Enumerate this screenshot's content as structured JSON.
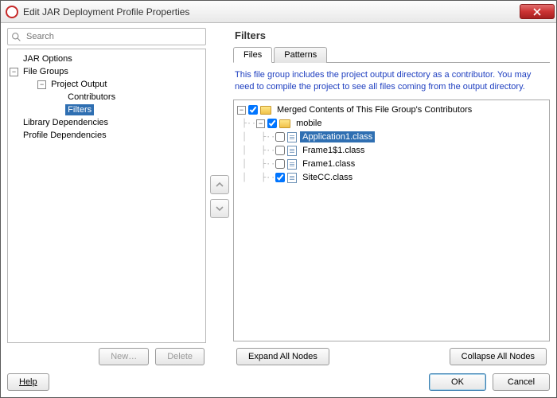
{
  "window": {
    "title": "Edit JAR Deployment Profile Properties"
  },
  "search": {
    "placeholder": "Search"
  },
  "navTree": [
    {
      "indent": 0,
      "toggle": "",
      "label": "JAR Options",
      "selected": false
    },
    {
      "indent": 0,
      "toggle": "-",
      "label": "File Groups",
      "selected": false
    },
    {
      "indent": 1,
      "toggle": "-",
      "label": "Project Output",
      "selected": false
    },
    {
      "indent": 2,
      "toggle": "",
      "label": "Contributors",
      "selected": false
    },
    {
      "indent": 2,
      "toggle": "",
      "label": "Filters",
      "selected": true
    },
    {
      "indent": 0,
      "toggle": "",
      "label": "Library Dependencies",
      "selected": false
    },
    {
      "indent": 0,
      "toggle": "",
      "label": "Profile Dependencies",
      "selected": false
    }
  ],
  "leftButtons": {
    "new": "New…",
    "delete": "Delete"
  },
  "section": {
    "title": "Filters"
  },
  "tabs": {
    "files": "Files",
    "patterns": "Patterns"
  },
  "hint": "This file group includes the project output directory as a contributor.  You may need to compile the project to see all files coming from the output directory.",
  "fileTree": [
    {
      "depth": 0,
      "toggle": "-",
      "checked": true,
      "kind": "folder",
      "label": "Merged Contents of This File Group's Contributors",
      "selected": false
    },
    {
      "depth": 1,
      "toggle": "-",
      "checked": true,
      "kind": "folder",
      "label": "mobile",
      "selected": false
    },
    {
      "depth": 2,
      "toggle": "",
      "checked": false,
      "kind": "file",
      "label": "Application1.class",
      "selected": true
    },
    {
      "depth": 2,
      "toggle": "",
      "checked": false,
      "kind": "file",
      "label": "Frame1$1.class",
      "selected": false
    },
    {
      "depth": 2,
      "toggle": "",
      "checked": false,
      "kind": "file",
      "label": "Frame1.class",
      "selected": false
    },
    {
      "depth": 2,
      "toggle": "",
      "checked": true,
      "kind": "file",
      "label": "SiteCC.class",
      "selected": false
    }
  ],
  "expand": {
    "all": "Expand All Nodes",
    "collapse": "Collapse All Nodes"
  },
  "footer": {
    "help": "Help",
    "ok": "OK",
    "cancel": "Cancel"
  }
}
